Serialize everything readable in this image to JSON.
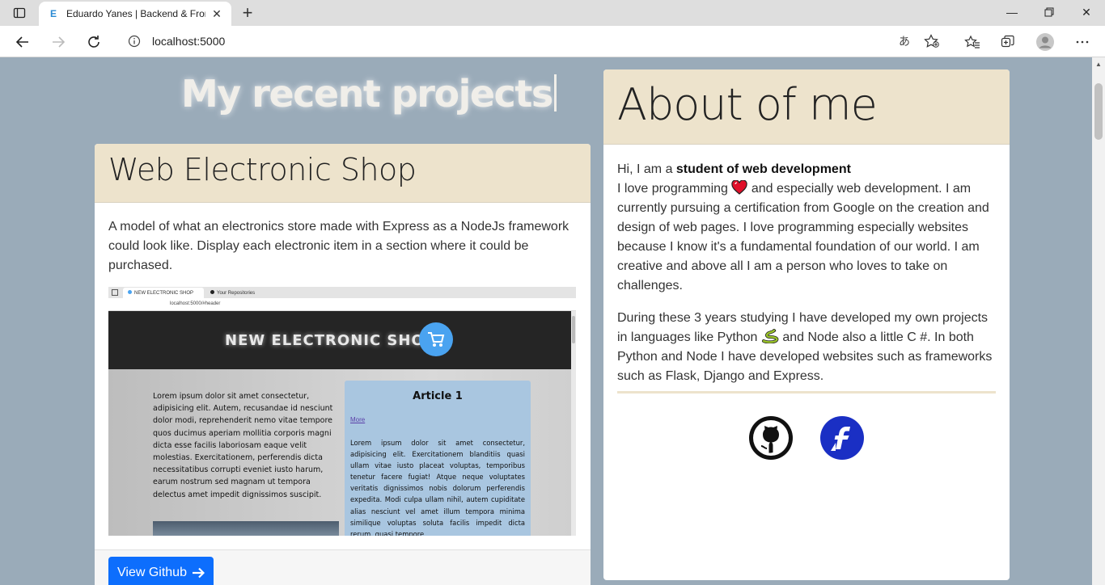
{
  "browser": {
    "tab_title": "Eduardo Yanes | Backend & Frontend",
    "favicon_letter": "E",
    "url": "localhost:5000"
  },
  "page": {
    "projects_heading": "My recent projects",
    "project": {
      "title": "Web Electronic Shop",
      "description": "A model of what an electronics store made with Express as a NodeJs framework could look like. Display each electronic item in a section where it could be purchased.",
      "button_label": "View Github",
      "screenshot": {
        "tab1": "NEW ELECTRONIC SHOP",
        "tab2": "Your Repositories",
        "url": "localhost:5000/#header",
        "shop_title": "NEW ELECTRONIC SHOP",
        "left_text": "Lorem ipsum dolor sit amet consectetur, adipisicing elit. Autem, recusandae id nesciunt dolor modi, reprehenderit nemo vitae tempore quos ducimus aperiam mollitia corporis magni dicta esse facilis laboriosam eaque velit molestias. Exercitationem, perferendis dicta necessitatibus corrupti eveniet iusto harum, earum nostrum sed magnam ut tempora delectus amet impedit dignissimos suscipit.",
        "article_title": "Article 1",
        "article_link": "More",
        "article_text": "Lorem ipsum dolor sit amet consectetur, adipisicing elit. Exercitationem blanditiis quasi ullam vitae iusto placeat voluptas, temporibus tenetur facere fugiat! Atque neque voluptates veritatis dignissimos nobis dolorum perferendis expedita. Modi culpa ullam nihil, autem cupiditate alias nesciunt vel amet illum tempora minima similique voluptas soluta facilis impedit dicta rerum, quasi tempore"
      }
    },
    "about": {
      "title": "About of me",
      "intro_prefix": "Hi, I am a ",
      "intro_bold": "student of web development",
      "p1_a": "I love programming",
      "p1_b": "and especially web development. I am currently pursuing a certification from Google on the creation and design of web pages. I love programming especially websites because I know it's a fundamental foundation of our world. I am creative and above all I am a person who loves to take on challenges.",
      "p2_a": "During these 3 years studying I have developed my own projects in languages like Python",
      "p2_b": "and Node also a little C #. In both Python and Node I have developed websites such as frameworks such as Flask, Django and Express."
    }
  },
  "colors": {
    "page_background": "#9aabb9",
    "card_header": "#ede3cc",
    "primary_button": "#0d6efd"
  }
}
